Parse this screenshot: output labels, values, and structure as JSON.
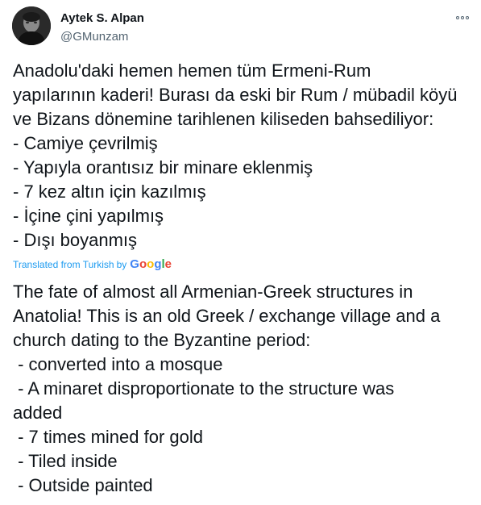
{
  "author": {
    "display_name": "Aytek S. Alpan",
    "handle": "@GMunzam"
  },
  "more_button": {
    "icon": "more-horizontal-icon"
  },
  "tweet": {
    "lines": [
      "Anadolu'daki hemen hemen tüm Ermeni-Rum",
      "yapılarının kaderi! Burası da eski bir Rum / mübadil köyü",
      "ve Bizans dönemine tarihlenen kiliseden bahsediliyor:",
      "- Camiye çevrilmiş",
      "- Yapıyla orantısız bir minare eklenmiş",
      "- 7 kez altın için kazılmış",
      "- İçine çini yapılmış",
      "- Dışı boyanmış"
    ]
  },
  "translation": {
    "label": "Translated from Turkish",
    "by": "by",
    "provider_letters": [
      "G",
      "o",
      "o",
      "g",
      "l",
      "e"
    ],
    "provider_colors": [
      "#4285F4",
      "#EA4335",
      "#FBBC05",
      "#4285F4",
      "#34A853",
      "#EA4335"
    ],
    "lines": [
      "The fate of almost all Armenian-Greek structures in",
      "Anatolia! This is an old Greek / exchange village and a",
      "church dating to the Byzantine period:",
      " - converted into a mosque",
      " - A minaret disproportionate to the structure was",
      "added",
      " - 7 times mined for gold",
      " - Tiled inside",
      " - Outside painted"
    ]
  },
  "colors": {
    "text": "#0f1419",
    "secondary": "#536471",
    "link": "#1d9bf0"
  }
}
